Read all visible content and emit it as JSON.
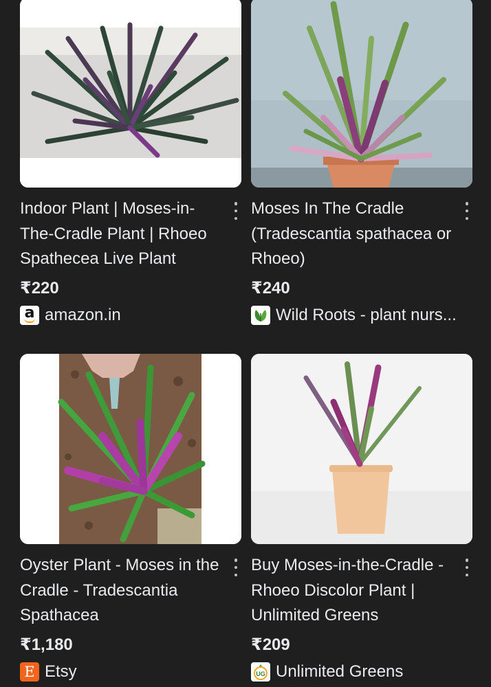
{
  "results": [
    {
      "title": "Indoor Plant | Moses-in-The-Cradle Plant | Rhoeo Spathecea Live Plant",
      "price": "₹220",
      "source": "amazon.in",
      "favicon": "amazon-icon"
    },
    {
      "title": "Moses In The Cradle (Tradescantia spathacea or Rhoeo)",
      "price": "₹240",
      "source": "Wild Roots - plant nurs...",
      "favicon": "wild-roots-icon"
    },
    {
      "title": "Oyster Plant - Moses in the Cradle - Tradescantia Spathacea",
      "price": "₹1,180",
      "source": "Etsy",
      "favicon": "etsy-icon"
    },
    {
      "title": "Buy Moses-in-the-Cradle - Rhoeo Discolor Plant | Unlimited Greens",
      "price": "₹209",
      "source": "Unlimited Greens",
      "favicon": "unlimited-greens-icon"
    }
  ],
  "favicon_letters": {
    "amazon": "a",
    "etsy": "E",
    "unlimited_greens": "UG"
  },
  "colors": {
    "background": "#1f1f1f",
    "text": "#e8eaed",
    "etsy_orange": "#f1641e",
    "amazon_orange": "#ff9900"
  }
}
